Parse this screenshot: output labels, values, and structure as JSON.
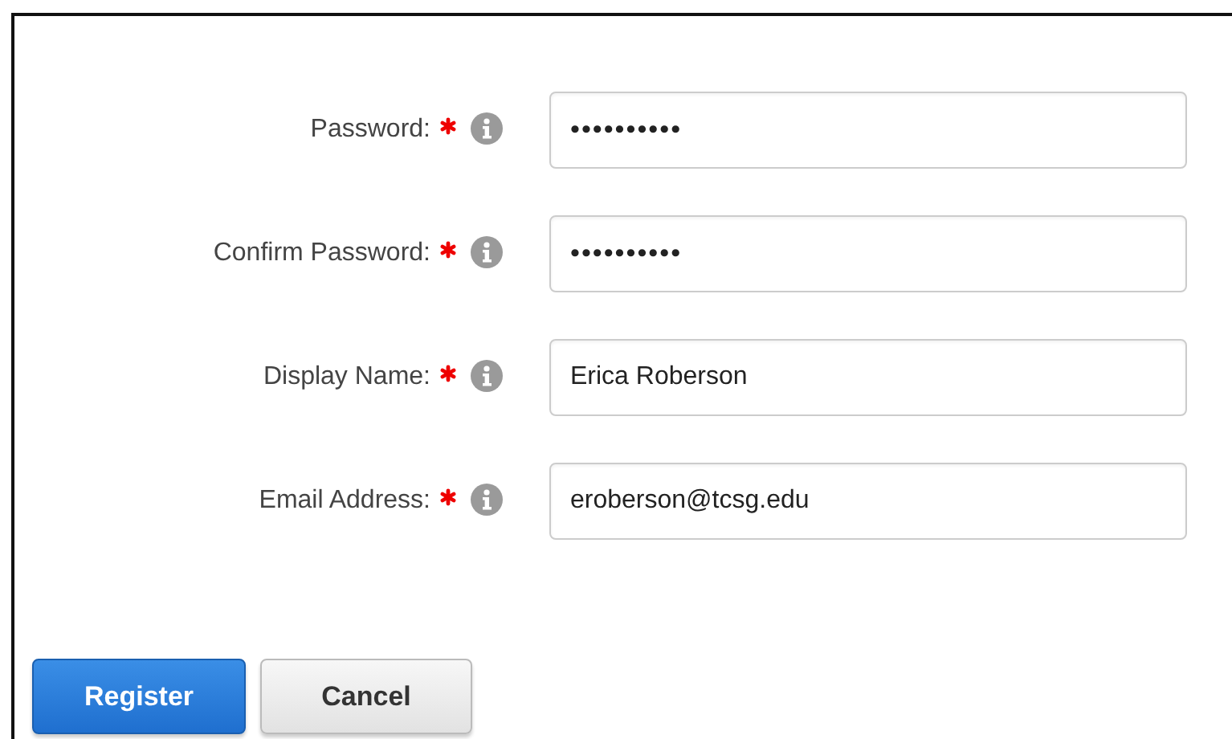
{
  "fields": [
    {
      "label": "Password:",
      "required": true,
      "value": "••••••••••",
      "kind": "password"
    },
    {
      "label": "Confirm Password:",
      "required": true,
      "value": "••••••••••",
      "kind": "password"
    },
    {
      "label": "Display Name:",
      "required": true,
      "value": "Erica Roberson",
      "kind": "text"
    },
    {
      "label": "Email Address:",
      "required": true,
      "value": "eroberson@tcsg.edu",
      "kind": "text"
    }
  ],
  "buttons": [
    {
      "label": "Register",
      "kind": "primary"
    },
    {
      "label": "Cancel",
      "kind": "secondary"
    }
  ]
}
